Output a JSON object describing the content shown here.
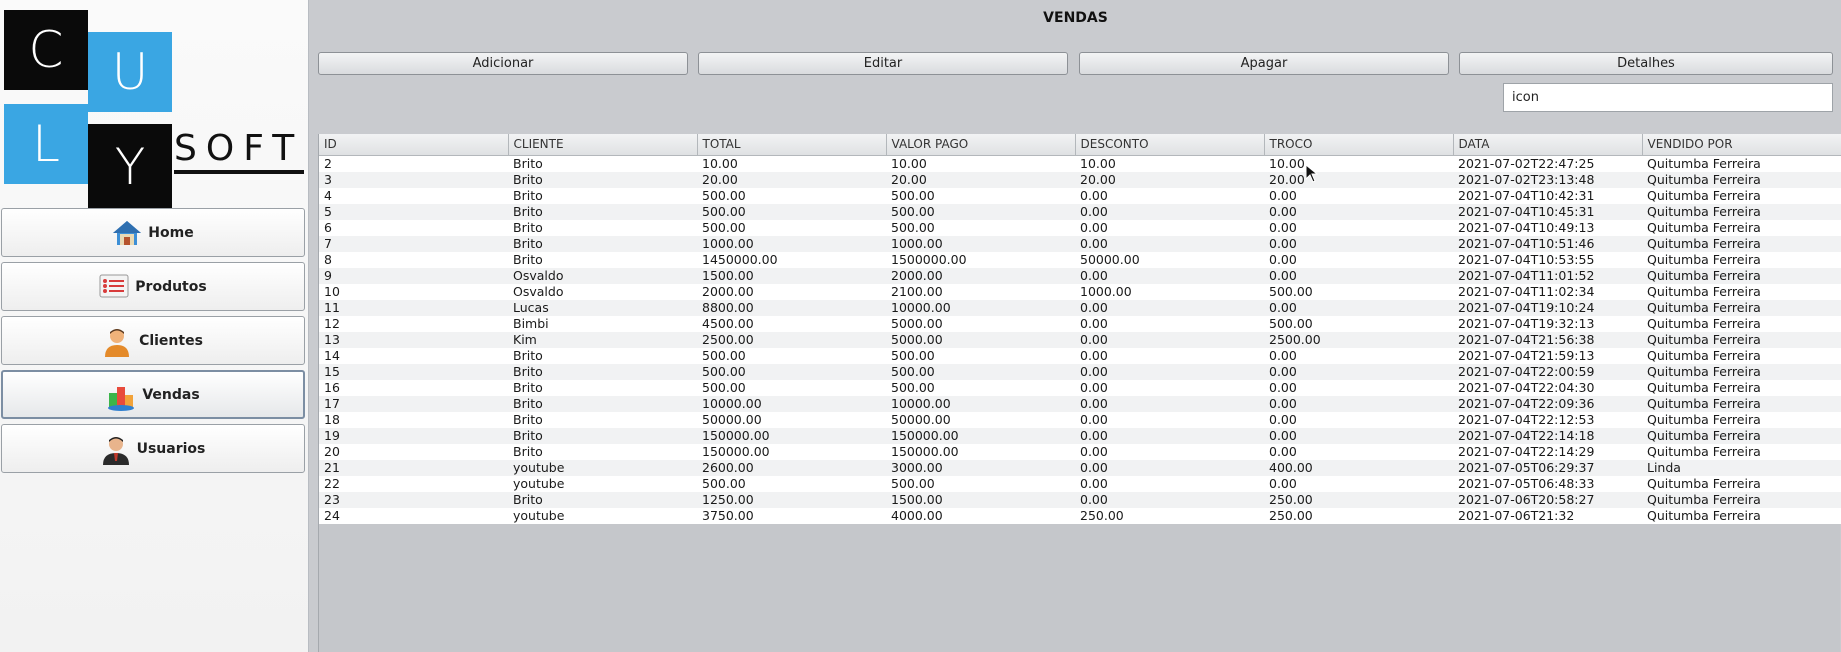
{
  "app": {
    "logo_letters": [
      "C",
      "U",
      "L",
      "Y"
    ],
    "logo_soft": "SOFT",
    "accent_blue": "#3aa6e3"
  },
  "sidebar": {
    "items": [
      {
        "label": "Home",
        "icon": "home-icon"
      },
      {
        "label": "Produtos",
        "icon": "product-list-icon"
      },
      {
        "label": "Clientes",
        "icon": "client-person-icon"
      },
      {
        "label": "Vendas",
        "icon": "sales-chart-icon",
        "active": true
      },
      {
        "label": "Usuarios",
        "icon": "user-suit-icon"
      }
    ]
  },
  "header": {
    "title": "VENDAS"
  },
  "toolbar": {
    "add_label": "Adicionar",
    "edit_label": "Editar",
    "delete_label": "Apagar",
    "details_label": "Detalhes"
  },
  "search": {
    "value": "icon"
  },
  "table": {
    "columns": [
      "ID",
      "CLIENTE",
      "TOTAL",
      "VALOR PAGO",
      "DESCONTO",
      "TROCO",
      "DATA",
      "VENDIDO POR"
    ],
    "rows": [
      [
        "2",
        "Brito",
        "10.00",
        "10.00",
        "10.00",
        "10.00",
        "2021-07-02T22:47:25",
        "Quitumba Ferreira"
      ],
      [
        "3",
        "Brito",
        "20.00",
        "20.00",
        "20.00",
        "20.00",
        "2021-07-02T23:13:48",
        "Quitumba Ferreira"
      ],
      [
        "4",
        "Brito",
        "500.00",
        "500.00",
        "0.00",
        "0.00",
        "2021-07-04T10:42:31",
        "Quitumba Ferreira"
      ],
      [
        "5",
        "Brito",
        "500.00",
        "500.00",
        "0.00",
        "0.00",
        "2021-07-04T10:45:31",
        "Quitumba Ferreira"
      ],
      [
        "6",
        "Brito",
        "500.00",
        "500.00",
        "0.00",
        "0.00",
        "2021-07-04T10:49:13",
        "Quitumba Ferreira"
      ],
      [
        "7",
        "Brito",
        "1000.00",
        "1000.00",
        "0.00",
        "0.00",
        "2021-07-04T10:51:46",
        "Quitumba Ferreira"
      ],
      [
        "8",
        "Brito",
        "1450000.00",
        "1500000.00",
        "50000.00",
        "0.00",
        "2021-07-04T10:53:55",
        "Quitumba Ferreira"
      ],
      [
        "9",
        "Osvaldo",
        "1500.00",
        "2000.00",
        "0.00",
        "0.00",
        "2021-07-04T11:01:52",
        "Quitumba Ferreira"
      ],
      [
        "10",
        "Osvaldo",
        "2000.00",
        "2100.00",
        "1000.00",
        "500.00",
        "2021-07-04T11:02:34",
        "Quitumba Ferreira"
      ],
      [
        "11",
        "Lucas",
        "8800.00",
        "10000.00",
        "0.00",
        "0.00",
        "2021-07-04T19:10:24",
        "Quitumba Ferreira"
      ],
      [
        "12",
        "Bimbi",
        "4500.00",
        "5000.00",
        "0.00",
        "500.00",
        "2021-07-04T19:32:13",
        "Quitumba Ferreira"
      ],
      [
        "13",
        "Kim",
        "2500.00",
        "5000.00",
        "0.00",
        "2500.00",
        "2021-07-04T21:56:38",
        "Quitumba Ferreira"
      ],
      [
        "14",
        "Brito",
        "500.00",
        "500.00",
        "0.00",
        "0.00",
        "2021-07-04T21:59:13",
        "Quitumba Ferreira"
      ],
      [
        "15",
        "Brito",
        "500.00",
        "500.00",
        "0.00",
        "0.00",
        "2021-07-04T22:00:59",
        "Quitumba Ferreira"
      ],
      [
        "16",
        "Brito",
        "500.00",
        "500.00",
        "0.00",
        "0.00",
        "2021-07-04T22:04:30",
        "Quitumba Ferreira"
      ],
      [
        "17",
        "Brito",
        "10000.00",
        "10000.00",
        "0.00",
        "0.00",
        "2021-07-04T22:09:36",
        "Quitumba Ferreira"
      ],
      [
        "18",
        "Brito",
        "50000.00",
        "50000.00",
        "0.00",
        "0.00",
        "2021-07-04T22:12:53",
        "Quitumba Ferreira"
      ],
      [
        "19",
        "Brito",
        "150000.00",
        "150000.00",
        "0.00",
        "0.00",
        "2021-07-04T22:14:18",
        "Quitumba Ferreira"
      ],
      [
        "20",
        "Brito",
        "150000.00",
        "150000.00",
        "0.00",
        "0.00",
        "2021-07-04T22:14:29",
        "Quitumba Ferreira"
      ],
      [
        "21",
        "youtube",
        "2600.00",
        "3000.00",
        "0.00",
        "400.00",
        "2021-07-05T06:29:37",
        "Linda"
      ],
      [
        "22",
        "youtube",
        "500.00",
        "500.00",
        "0.00",
        "0.00",
        "2021-07-05T06:48:33",
        "Quitumba Ferreira"
      ],
      [
        "23",
        "Brito",
        "1250.00",
        "1500.00",
        "0.00",
        "250.00",
        "2021-07-06T20:58:27",
        "Quitumba Ferreira"
      ],
      [
        "24",
        "youtube",
        "3750.00",
        "4000.00",
        "250.00",
        "250.00",
        "2021-07-06T21:32",
        "Quitumba Ferreira"
      ]
    ]
  }
}
